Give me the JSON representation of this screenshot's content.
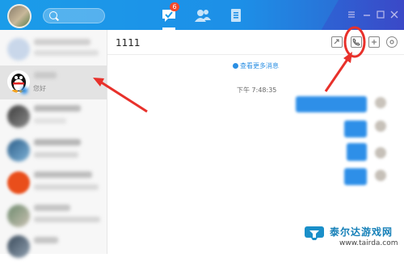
{
  "window": {
    "nav_badge": "6"
  },
  "chat": {
    "title": "1111",
    "view_more": "查看更多消息",
    "timestamp": "下午 7:48:35"
  },
  "sidebar": {
    "items": [
      {
        "message": ""
      },
      {
        "message": "您好"
      },
      {
        "message": ""
      },
      {
        "message": ""
      },
      {
        "message": ""
      },
      {
        "message": ""
      },
      {
        "message": ""
      }
    ]
  },
  "watermark": {
    "title": "泰尔达游戏网",
    "url": "www.tairda.com"
  },
  "colors": {
    "accent": "#1b9ce9",
    "bubble": "#2e8fe8",
    "annotation": "#e8312b"
  }
}
